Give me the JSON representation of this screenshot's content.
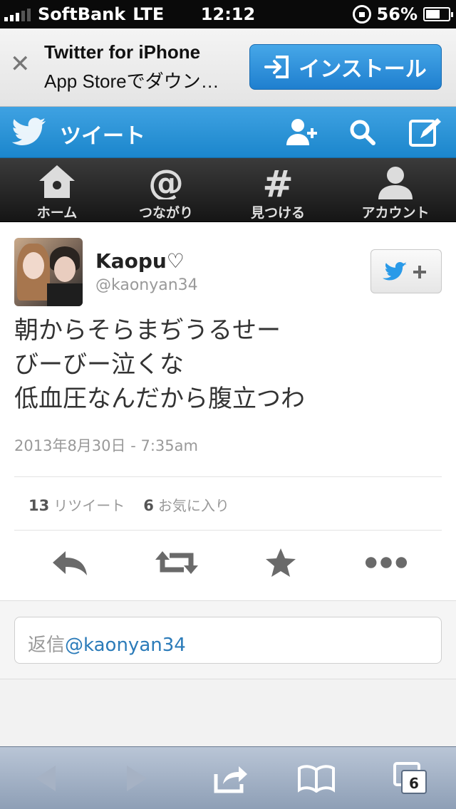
{
  "status_bar": {
    "carrier": "SoftBank",
    "network": "LTE",
    "time": "12:12",
    "battery_percent": "56%",
    "battery_level": 0.56,
    "signal_bars_on": 3,
    "signal_bars_total": 5
  },
  "app_banner": {
    "close_icon": "close-icon",
    "title": "Twitter for iPhone",
    "subtitle": "App Storeでダウン…",
    "install_label": "インストール"
  },
  "header": {
    "title": "ツイート",
    "icons": [
      "twitter-bird-icon",
      "add-user-icon",
      "search-icon",
      "compose-icon"
    ]
  },
  "tabs": [
    {
      "label": "ホーム",
      "icon": "home-icon"
    },
    {
      "label": "つながり",
      "icon": "at-icon"
    },
    {
      "label": "見つける",
      "icon": "hashtag-icon"
    },
    {
      "label": "アカウント",
      "icon": "person-icon"
    }
  ],
  "tweet": {
    "name": "Kaopu♡",
    "handle": "@kaonyan34",
    "lines": [
      "朝からそらまぢうるせー",
      "びーびー泣くな",
      "低血圧なんだから腹立つわ"
    ],
    "timestamp": "2013年8月30日 - 7:35am",
    "retweet_count": "13",
    "retweet_label": "リツイート",
    "favorite_count": "6",
    "favorite_label": "お気に入り"
  },
  "reply": {
    "prefix": "返信",
    "mention": "@kaonyan34"
  },
  "safari_toolbar": {
    "tab_count": "6",
    "icons": [
      "back-icon",
      "forward-icon",
      "share-icon",
      "bookmarks-icon",
      "tabs-icon"
    ]
  },
  "colors": {
    "twitter_blue": "#1b86cc",
    "install_blue": "#1f7fcf",
    "tabbar_dark": "#151515",
    "mention_blue": "#2b7bb9"
  }
}
